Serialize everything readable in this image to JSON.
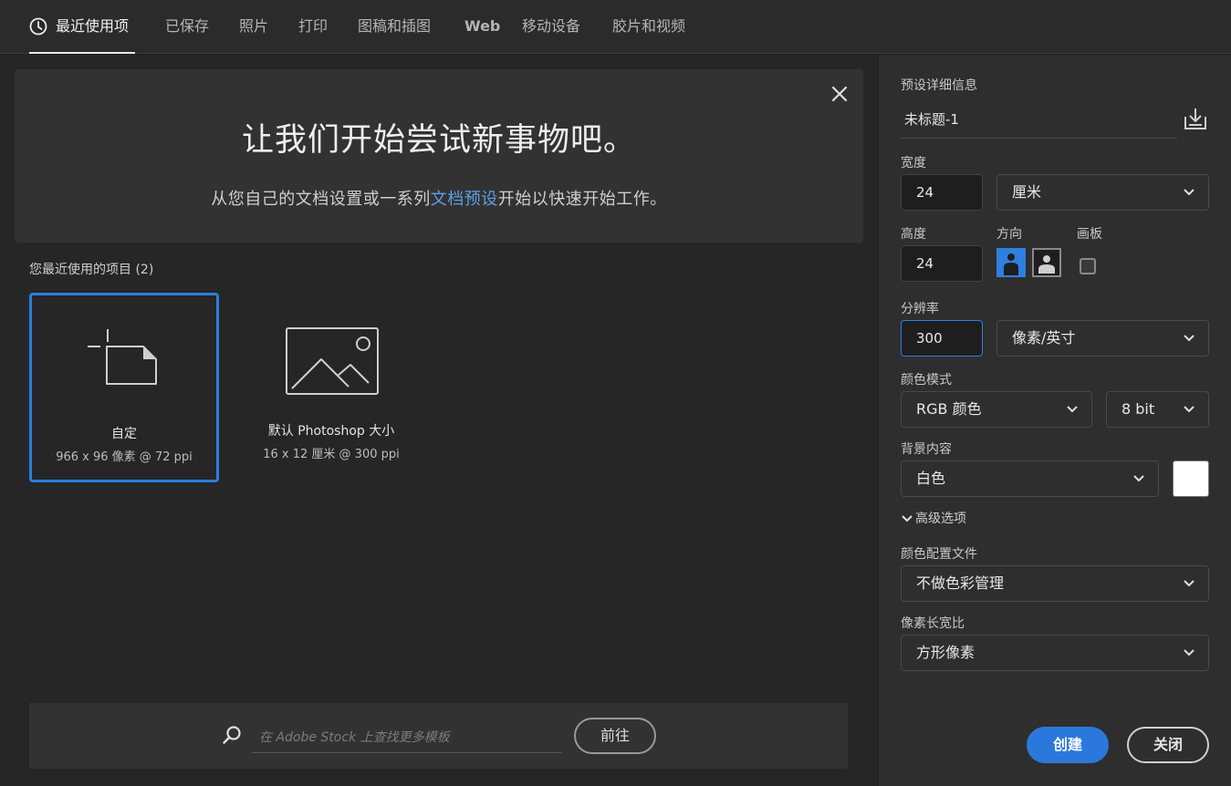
{
  "tabs": [
    {
      "label": "最近使用项",
      "active": true
    },
    {
      "label": "已保存"
    },
    {
      "label": "照片"
    },
    {
      "label": "打印"
    },
    {
      "label": "图稿和插图"
    },
    {
      "label": "Web"
    },
    {
      "label": "移动设备"
    },
    {
      "label": "胶片和视频"
    }
  ],
  "banner": {
    "title": "让我们开始尝试新事物吧。",
    "sub_before": "从您自己的文档设置或一系列",
    "sub_link": "文档预设",
    "sub_after": "开始以快速开始工作。"
  },
  "recent": {
    "heading": "您最近使用的项目 (2)",
    "items": [
      {
        "name": "自定",
        "meta": "966 x 96 像素 @ 72 ppi",
        "icon": "custom-document-icon",
        "selected": true
      },
      {
        "name": "默认 Photoshop 大小",
        "meta": "16 x 12 厘米 @ 300 ppi",
        "icon": "image-icon",
        "selected": false
      }
    ]
  },
  "stock": {
    "placeholder": "在 Adobe Stock 上查找更多模板",
    "go_label": "前往"
  },
  "preset": {
    "section_label": "预设详细信息",
    "name": "未标题-1",
    "width_label": "宽度",
    "width_value": "24",
    "width_unit": "厘米",
    "height_label": "高度",
    "height_value": "24",
    "orientation_label": "方向",
    "artboard_label": "画板",
    "resolution_label": "分辨率",
    "resolution_value": "300",
    "resolution_unit": "像素/英寸",
    "color_mode_label": "颜色模式",
    "color_mode": "RGB 颜色",
    "bit_depth": "8 bit",
    "background_label": "背景内容",
    "background": "白色",
    "background_color": "#ffffff",
    "advanced_label": "高级选项",
    "color_profile_label": "颜色配置文件",
    "color_profile": "不做色彩管理",
    "pixel_aspect_label": "像素长宽比",
    "pixel_aspect": "方形像素",
    "create_label": "创建",
    "close_label": "关闭"
  },
  "colors": {
    "accent": "#2b78dd",
    "link": "#5c9fe6"
  }
}
